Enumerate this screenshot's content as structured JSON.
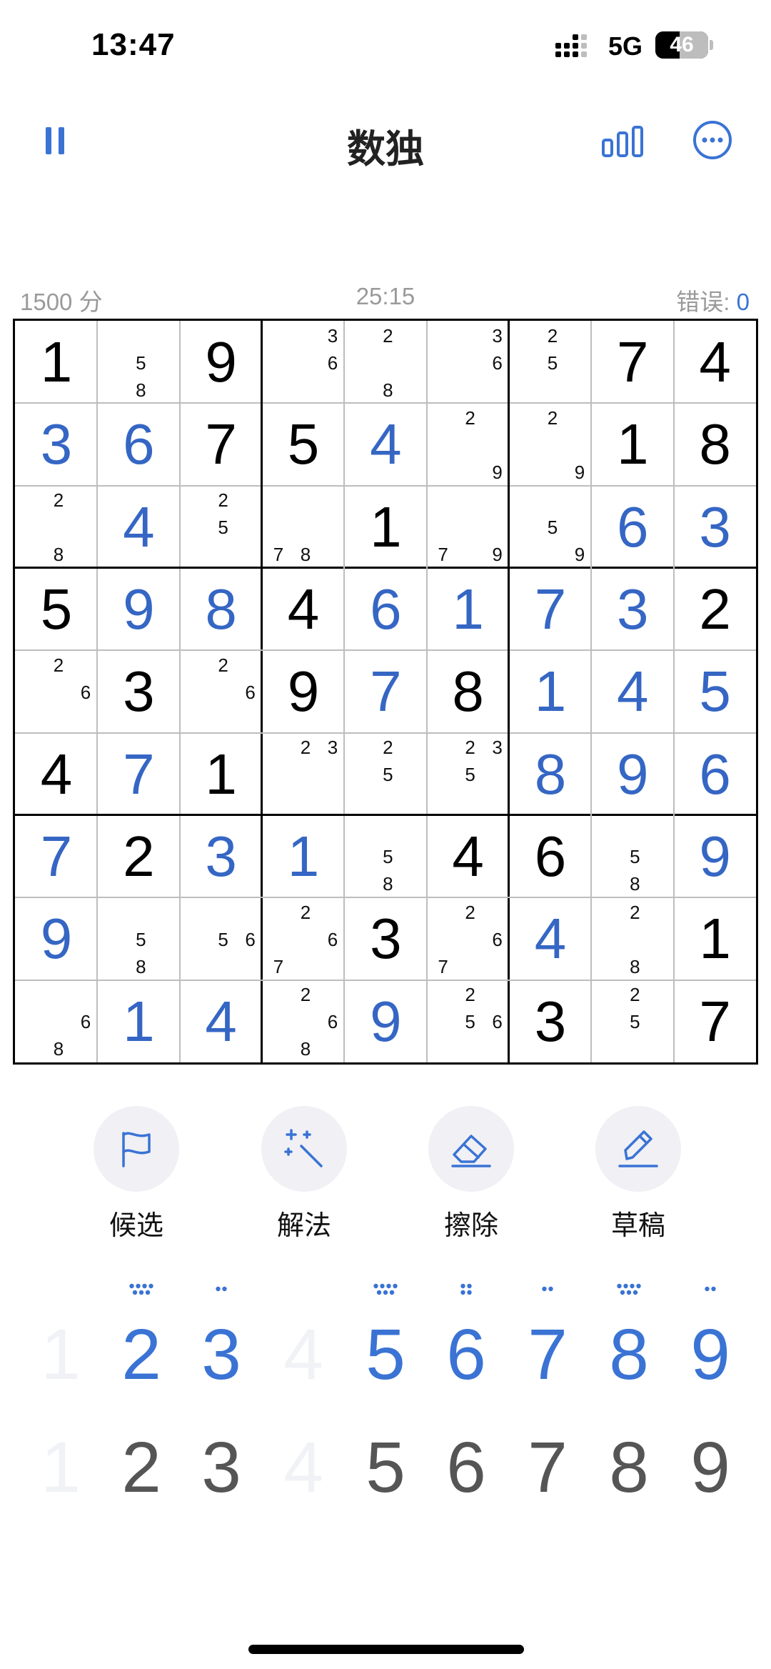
{
  "status_bar": {
    "time": "13:47",
    "network": "5G",
    "battery": "46"
  },
  "header": {
    "title": "数独",
    "pause_icon": "pause-icon",
    "stats_icon": "bar-chart-icon",
    "more_icon": "more-icon"
  },
  "info": {
    "score": "1500 分",
    "timer": "25:15",
    "errors_label": "错误: ",
    "errors_value": "0"
  },
  "colors": {
    "accent": "#3a73d4",
    "user_digit": "#3566c4",
    "given_digit": "#000000",
    "thin_line": "#bdbdbd"
  },
  "board": [
    [
      {
        "v": "1",
        "t": "g"
      },
      {
        "n": [
          5,
          8
        ]
      },
      {
        "v": "9",
        "t": "g"
      },
      {
        "n": [
          3,
          6
        ]
      },
      {
        "n": [
          2,
          8
        ]
      },
      {
        "n": [
          3,
          6
        ]
      },
      {
        "n": [
          2,
          5
        ]
      },
      {
        "v": "7",
        "t": "g"
      },
      {
        "v": "4",
        "t": "g"
      }
    ],
    [
      {
        "v": "3",
        "t": "u"
      },
      {
        "v": "6",
        "t": "u"
      },
      {
        "v": "7",
        "t": "g"
      },
      {
        "v": "5",
        "t": "g"
      },
      {
        "v": "4",
        "t": "u"
      },
      {
        "n": [
          2,
          9
        ]
      },
      {
        "n": [
          2,
          9
        ]
      },
      {
        "v": "1",
        "t": "g"
      },
      {
        "v": "8",
        "t": "g"
      }
    ],
    [
      {
        "n": [
          2,
          8
        ]
      },
      {
        "v": "4",
        "t": "u"
      },
      {
        "n": [
          2,
          5
        ]
      },
      {
        "n": [
          7,
          8
        ]
      },
      {
        "v": "1",
        "t": "g"
      },
      {
        "n": [
          7,
          9
        ]
      },
      {
        "n": [
          5,
          9
        ]
      },
      {
        "v": "6",
        "t": "u"
      },
      {
        "v": "3",
        "t": "u"
      }
    ],
    [
      {
        "v": "5",
        "t": "g"
      },
      {
        "v": "9",
        "t": "u"
      },
      {
        "v": "8",
        "t": "u"
      },
      {
        "v": "4",
        "t": "g"
      },
      {
        "v": "6",
        "t": "u"
      },
      {
        "v": "1",
        "t": "u"
      },
      {
        "v": "7",
        "t": "u"
      },
      {
        "v": "3",
        "t": "u"
      },
      {
        "v": "2",
        "t": "g"
      }
    ],
    [
      {
        "n": [
          2,
          6
        ]
      },
      {
        "v": "3",
        "t": "g"
      },
      {
        "n": [
          2,
          6
        ]
      },
      {
        "v": "9",
        "t": "g"
      },
      {
        "v": "7",
        "t": "u"
      },
      {
        "v": "8",
        "t": "g"
      },
      {
        "v": "1",
        "t": "u"
      },
      {
        "v": "4",
        "t": "u"
      },
      {
        "v": "5",
        "t": "u"
      }
    ],
    [
      {
        "v": "4",
        "t": "g"
      },
      {
        "v": "7",
        "t": "u"
      },
      {
        "v": "1",
        "t": "g"
      },
      {
        "n": [
          2,
          3
        ]
      },
      {
        "n": [
          2,
          5
        ]
      },
      {
        "n": [
          2,
          3,
          5
        ]
      },
      {
        "v": "8",
        "t": "u"
      },
      {
        "v": "9",
        "t": "u"
      },
      {
        "v": "6",
        "t": "u"
      }
    ],
    [
      {
        "v": "7",
        "t": "u"
      },
      {
        "v": "2",
        "t": "g"
      },
      {
        "v": "3",
        "t": "u"
      },
      {
        "v": "1",
        "t": "u"
      },
      {
        "n": [
          5,
          8
        ]
      },
      {
        "v": "4",
        "t": "g"
      },
      {
        "v": "6",
        "t": "g"
      },
      {
        "n": [
          5,
          8
        ]
      },
      {
        "v": "9",
        "t": "u"
      }
    ],
    [
      {
        "v": "9",
        "t": "u"
      },
      {
        "n": [
          5,
          8
        ]
      },
      {
        "n": [
          5,
          6
        ]
      },
      {
        "n": [
          2,
          6,
          7
        ]
      },
      {
        "v": "3",
        "t": "g"
      },
      {
        "n": [
          2,
          6,
          7
        ]
      },
      {
        "v": "4",
        "t": "u"
      },
      {
        "n": [
          2,
          8
        ]
      },
      {
        "v": "1",
        "t": "g"
      }
    ],
    [
      {
        "n": [
          6,
          8
        ]
      },
      {
        "v": "1",
        "t": "u"
      },
      {
        "v": "4",
        "t": "u"
      },
      {
        "n": [
          2,
          6,
          8
        ]
      },
      {
        "v": "9",
        "t": "u"
      },
      {
        "n": [
          2,
          5,
          6
        ]
      },
      {
        "v": "3",
        "t": "g"
      },
      {
        "n": [
          2,
          5
        ]
      },
      {
        "v": "7",
        "t": "g"
      }
    ]
  ],
  "tools": [
    {
      "label": "候选",
      "icon": "flag-icon"
    },
    {
      "label": "解法",
      "icon": "magic-wand-icon"
    },
    {
      "label": "擦除",
      "icon": "eraser-icon"
    },
    {
      "label": "草稿",
      "icon": "pencil-icon"
    }
  ],
  "pad": [
    {
      "digit": "1",
      "done": true,
      "remaining": 0
    },
    {
      "digit": "2",
      "done": false,
      "remaining": 7
    },
    {
      "digit": "3",
      "done": false,
      "remaining": 2
    },
    {
      "digit": "4",
      "done": true,
      "remaining": 0
    },
    {
      "digit": "5",
      "done": false,
      "remaining": 7
    },
    {
      "digit": "6",
      "done": false,
      "remaining": 4
    },
    {
      "digit": "7",
      "done": false,
      "remaining": 2
    },
    {
      "digit": "8",
      "done": false,
      "remaining": 7
    },
    {
      "digit": "9",
      "done": false,
      "remaining": 2
    }
  ]
}
